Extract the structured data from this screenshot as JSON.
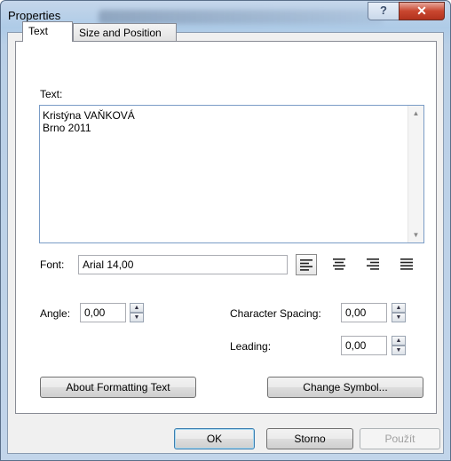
{
  "window": {
    "title": "Properties",
    "help_label": "?",
    "close_label": "x"
  },
  "tabs": [
    {
      "label": "Text",
      "active": true
    },
    {
      "label": "Size and Position",
      "active": false
    }
  ],
  "text_section": {
    "label": "Text:",
    "content": "Kristýna VAŇKOVÁ\nBrno 2011"
  },
  "font": {
    "label": "Font:",
    "value": "Arial 14,00"
  },
  "alignment": {
    "options": [
      "align-left",
      "align-center",
      "align-right",
      "align-justify"
    ],
    "selected": "align-left"
  },
  "angle": {
    "label": "Angle:",
    "value": "0,00"
  },
  "character_spacing": {
    "label": "Character Spacing:",
    "value": "0,00"
  },
  "leading": {
    "label": "Leading:",
    "value": "0,00"
  },
  "buttons": {
    "about_formatting": "About Formatting Text",
    "change_symbol": "Change Symbol...",
    "ok": "OK",
    "cancel": "Storno",
    "apply": "Použít"
  }
}
